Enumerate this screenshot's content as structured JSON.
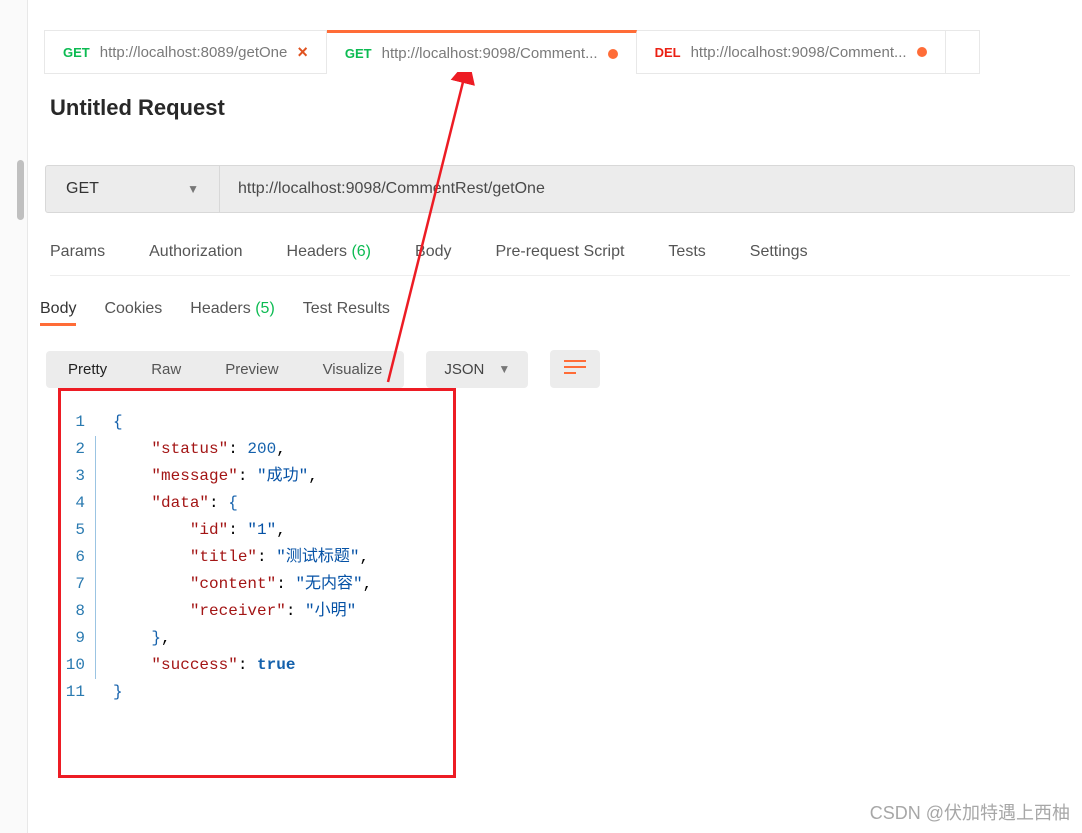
{
  "tabs": [
    {
      "method": "GET",
      "url": "http://localhost:8089/getOne",
      "dirty": false,
      "closable": true
    },
    {
      "method": "GET",
      "url": "http://localhost:9098/Comment...",
      "dirty": true,
      "closable": false,
      "active": true
    },
    {
      "method": "DEL",
      "url": "http://localhost:9098/Comment...",
      "dirty": true,
      "closable": false
    }
  ],
  "title": "Untitled Request",
  "request": {
    "method": "GET",
    "url": "http://localhost:9098/CommentRest/getOne"
  },
  "reqTabs": {
    "params": "Params",
    "auth": "Authorization",
    "headers": "Headers",
    "headersCount": "(6)",
    "body": "Body",
    "prereq": "Pre-request Script",
    "tests": "Tests",
    "settings": "Settings"
  },
  "respTabs": {
    "body": "Body",
    "cookies": "Cookies",
    "headers": "Headers",
    "headersCount": "(5)",
    "tests": "Test Results"
  },
  "viewTabs": {
    "pretty": "Pretty",
    "raw": "Raw",
    "preview": "Preview",
    "visualize": "Visualize",
    "format": "JSON"
  },
  "code": {
    "lines": [
      "1",
      "2",
      "3",
      "4",
      "5",
      "6",
      "7",
      "8",
      "9",
      "10",
      "11"
    ],
    "body": {
      "status_k": "\"status\"",
      "status_v": "200",
      "message_k": "\"message\"",
      "message_v": "\"成功\"",
      "data_k": "\"data\"",
      "id_k": "\"id\"",
      "id_v": "\"1\"",
      "title_k": "\"title\"",
      "title_v": "\"测试标题\"",
      "content_k": "\"content\"",
      "content_v": "\"无内容\"",
      "receiver_k": "\"receiver\"",
      "receiver_v": "\"小明\"",
      "success_k": "\"success\"",
      "success_v": "true"
    }
  },
  "watermark": "CSDN @伏加特遇上西柚"
}
